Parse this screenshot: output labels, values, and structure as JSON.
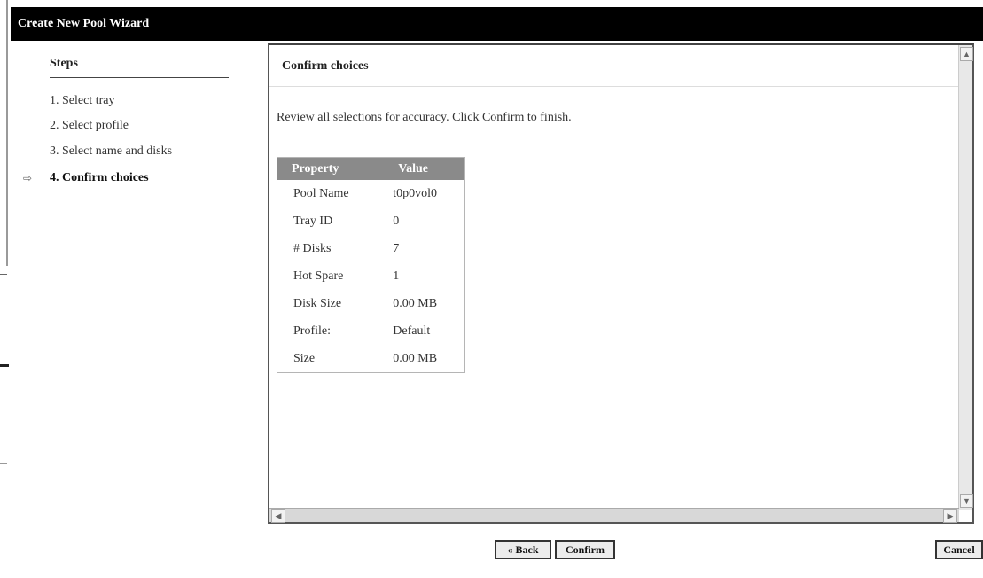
{
  "window": {
    "title": "Create New Pool Wizard"
  },
  "steps": {
    "title": "Steps",
    "items": [
      {
        "label": "1.  Select tray",
        "active": false
      },
      {
        "label": "2.  Select profile",
        "active": false
      },
      {
        "label": "3.  Select name and disks",
        "active": false
      },
      {
        "label": "4.  Confirm choices",
        "active": true
      }
    ],
    "current_marker": "⇨"
  },
  "content": {
    "header": "Confirm choices",
    "instructions": "Review all selections for accuracy. Click Confirm to finish.",
    "table": {
      "columns": [
        "Property",
        "Value"
      ],
      "rows": [
        [
          "Pool Name",
          "t0p0vol0"
        ],
        [
          "Tray ID",
          "0"
        ],
        [
          "# Disks",
          "7"
        ],
        [
          "Hot Spare",
          "1"
        ],
        [
          "Disk Size",
          "0.00 MB"
        ],
        [
          "Profile:",
          "Default"
        ],
        [
          "Size",
          "0.00 MB"
        ]
      ]
    }
  },
  "footer": {
    "back_label": "Back",
    "back_icon": "chevron-left-icon",
    "confirm_label": "Confirm",
    "cancel_label": "Cancel"
  },
  "colors": {
    "titlebar": "#000000",
    "table_header": "#8a8a8a"
  }
}
